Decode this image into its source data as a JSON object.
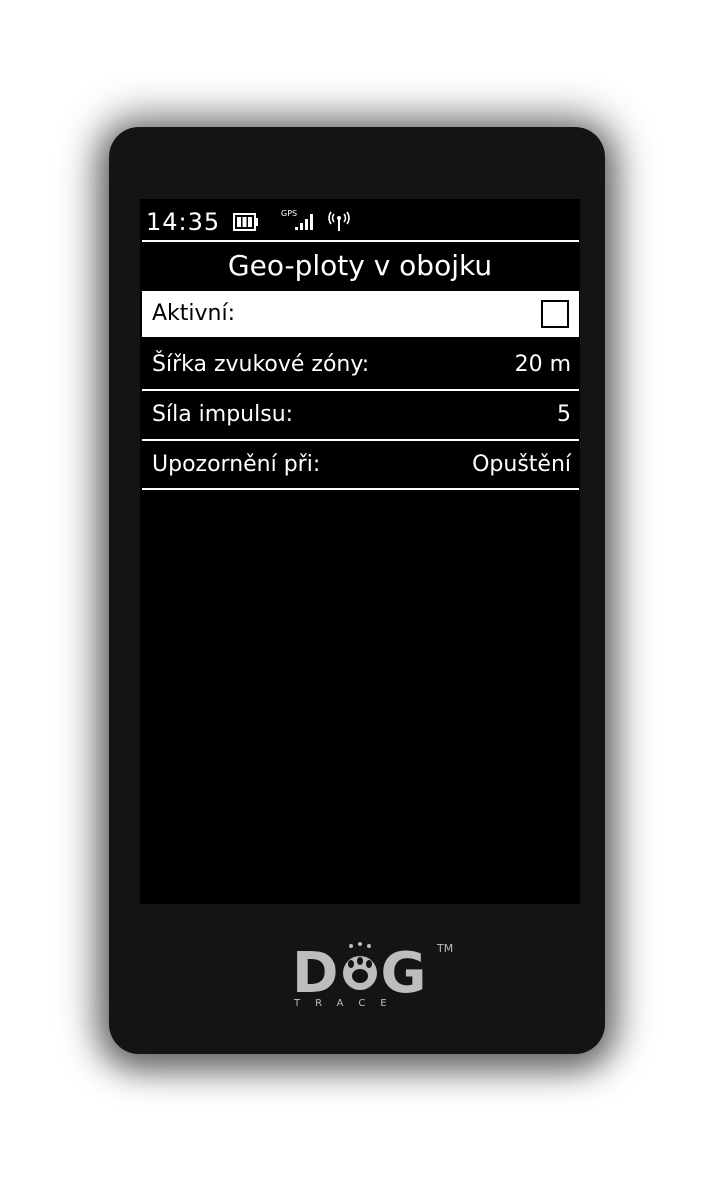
{
  "status": {
    "time": "14:35",
    "icons": [
      "battery-icon",
      "gps-signal-icon",
      "antenna-icon"
    ],
    "gps_label": "GPS"
  },
  "screen": {
    "title": "Geo-ploty v obojku",
    "rows": [
      {
        "label": "Aktivní:",
        "value": "",
        "control": "checkbox",
        "checked": false,
        "selected": true
      },
      {
        "label": "Šířka zvukové zóny:",
        "value": "20 m",
        "selected": false
      },
      {
        "label": "Síla impulsu:",
        "value": "5",
        "selected": false
      },
      {
        "label": "Upozornění při:",
        "value": "Opuštění",
        "selected": false
      }
    ]
  },
  "brand": {
    "letters_left": "D",
    "letters_right": "G",
    "trademark": "TM",
    "subtitle": "TRACE"
  },
  "colors": {
    "screen_bg": "#000000",
    "text": "#ffffff",
    "selected_bg": "#ffffff",
    "device_body": "#141414",
    "logo": "#bdbdbd"
  }
}
